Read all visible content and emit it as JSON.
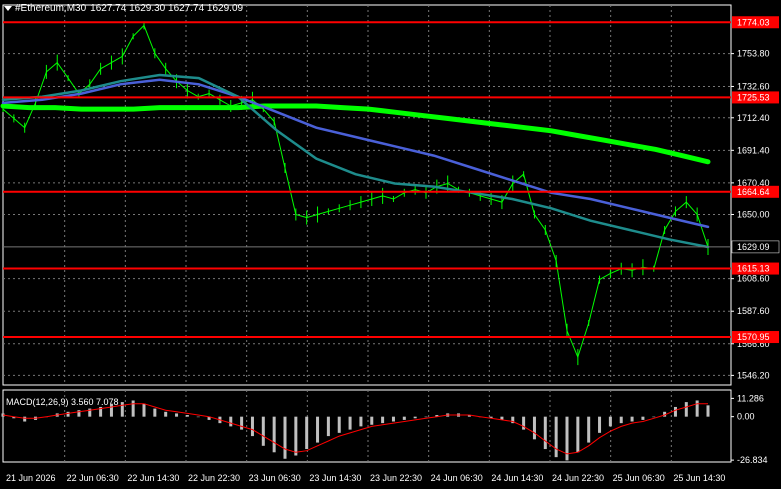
{
  "header": {
    "symbol": "#Ethereum,M30",
    "ohlc": "1627.74 1629.30 1627.74 1629.09"
  },
  "chart_data": {
    "type": "candlestick",
    "price_axis": {
      "ticks": [
        "1753.80",
        "1732.60",
        "1712.40",
        "1691.40",
        "1670.40",
        "1650.00",
        "1608.60",
        "1587.60",
        "1566.60",
        "1546.20"
      ],
      "range": [
        1540,
        1780
      ]
    },
    "current_price": "1629.09",
    "horizontal_levels": [
      {
        "label": "1774.03",
        "value": 1774.03
      },
      {
        "label": "1725.53",
        "value": 1725.53
      },
      {
        "label": "1664.64",
        "value": 1664.64
      },
      {
        "label": "1615.13",
        "value": 1615.13
      },
      {
        "label": "1570.95",
        "value": 1570.95
      }
    ],
    "time_axis": [
      "21 Jun 2026",
      "22 Jun 06:30",
      "22 Jun 14:30",
      "22 Jun 22:30",
      "23 Jun 06:30",
      "23 Jun 14:30",
      "23 Jun 22:30",
      "24 Jun 06:30",
      "24 Jun 14:30",
      "24 Jun 22:30",
      "25 Jun 06:30",
      "25 Jun 14:30"
    ],
    "price_series": [
      1718,
      1712,
      1706,
      1722,
      1742,
      1748,
      1738,
      1728,
      1734,
      1744,
      1748,
      1752,
      1765,
      1772,
      1754,
      1744,
      1736,
      1730,
      1726,
      1728,
      1724,
      1720,
      1722,
      1724,
      1718,
      1710,
      1680,
      1650,
      1648,
      1650,
      1652,
      1654,
      1656,
      1658,
      1660,
      1662,
      1660,
      1664,
      1666,
      1664,
      1668,
      1670,
      1666,
      1664,
      1662,
      1660,
      1658,
      1670,
      1676,
      1650,
      1640,
      1620,
      1575,
      1558,
      1580,
      1608,
      1612,
      1615,
      1614,
      1616,
      1615,
      1640,
      1652,
      1658,
      1650,
      1629
    ],
    "moving_averages": [
      {
        "color": "#00ff00",
        "values": [
          1720,
          1719,
          1719,
          1718,
          1718,
          1718,
          1719,
          1719,
          1719,
          1719,
          1720,
          1720,
          1720,
          1719,
          1718,
          1716,
          1714,
          1712,
          1710,
          1708,
          1706,
          1704,
          1701,
          1698,
          1695,
          1692,
          1688,
          1684
        ]
      },
      {
        "color": "#4a60d8",
        "values": [
          1722,
          1724,
          1728,
          1734,
          1737,
          1734,
          1726,
          1716,
          1706,
          1700,
          1694,
          1688,
          1680,
          1672,
          1664,
          1660,
          1654,
          1648,
          1642
        ]
      },
      {
        "color": "#1e8c8c",
        "values": [
          1724,
          1726,
          1730,
          1736,
          1740,
          1738,
          1726,
          1704,
          1686,
          1676,
          1670,
          1668,
          1664,
          1660,
          1654,
          1646,
          1640,
          1634,
          1629
        ]
      }
    ],
    "macd": {
      "label": "MACD(12,26,9) 3.560 7.078",
      "ticks": [
        "11.286",
        "0.00",
        "-26.834"
      ],
      "range": [
        -28,
        14
      ],
      "histogram": [
        2,
        -1,
        -3,
        -2,
        0,
        2,
        3,
        4,
        5,
        6,
        8,
        9,
        10,
        8,
        5,
        3,
        2,
        1,
        0,
        -2,
        -4,
        -6,
        -8,
        -12,
        -18,
        -22,
        -26,
        -24,
        -20,
        -16,
        -12,
        -10,
        -8,
        -6,
        -5,
        -4,
        -3,
        -2,
        -1,
        0,
        1,
        2,
        2,
        1,
        0,
        -1,
        -2,
        -4,
        -8,
        -14,
        -20,
        -25,
        -27,
        -22,
        -16,
        -10,
        -6,
        -4,
        -3,
        -2,
        0,
        3,
        6,
        9,
        10,
        7
      ],
      "signal": [
        1,
        0,
        -1,
        -1,
        0,
        1,
        2,
        3,
        4,
        5,
        6,
        7,
        8,
        8,
        6,
        4,
        3,
        2,
        1,
        0,
        -2,
        -4,
        -6,
        -8,
        -12,
        -16,
        -20,
        -22,
        -21,
        -18,
        -15,
        -12,
        -10,
        -8,
        -6,
        -5,
        -4,
        -3,
        -2,
        -1,
        0,
        1,
        1,
        1,
        0,
        -1,
        -2,
        -3,
        -6,
        -10,
        -15,
        -20,
        -23,
        -22,
        -18,
        -13,
        -9,
        -6,
        -4,
        -3,
        -1,
        1,
        4,
        6,
        8,
        8
      ]
    }
  }
}
